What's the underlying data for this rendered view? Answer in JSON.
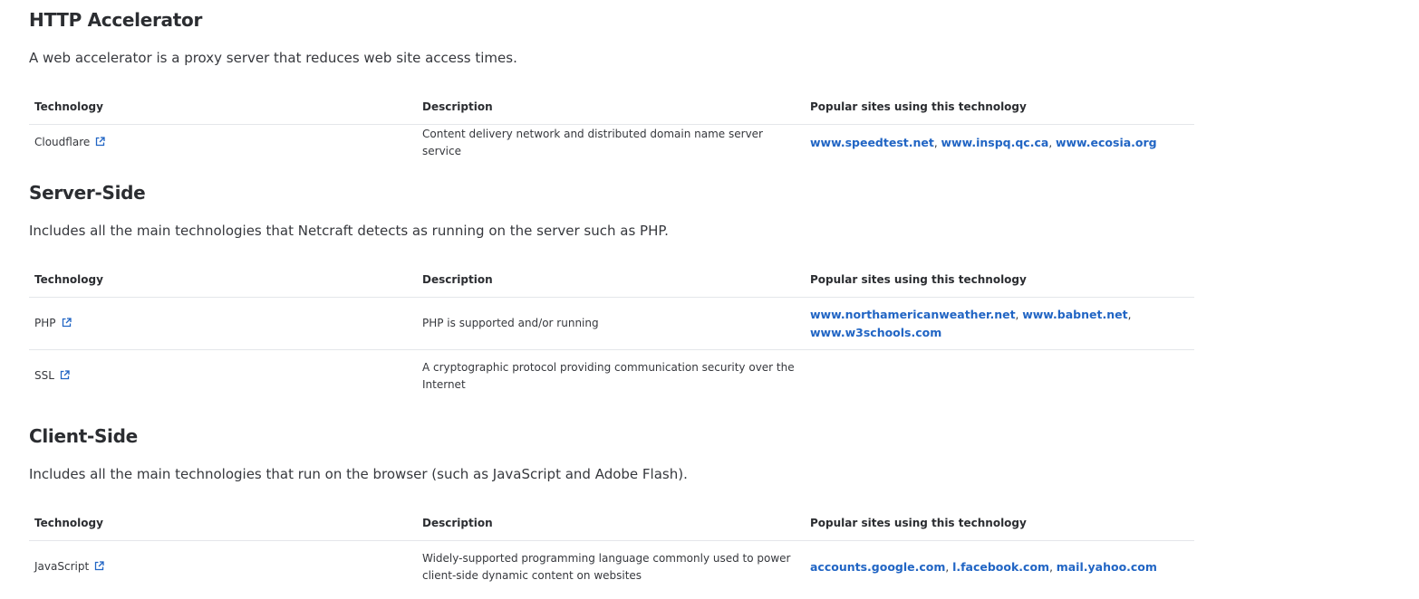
{
  "sections": [
    {
      "title": "HTTP Accelerator",
      "intro": "A web accelerator is a proxy server that reduces web site access times.",
      "columns": [
        "Technology",
        "Description",
        "Popular sites using this technology"
      ],
      "rows": [
        {
          "technology": "Cloudflare",
          "description": "Content delivery network and distributed domain name server service",
          "sites": [
            "www.speedtest.net",
            "www.inspq.qc.ca",
            "www.ecosia.org"
          ]
        }
      ]
    },
    {
      "title": "Server-Side",
      "intro": "Includes all the main technologies that Netcraft detects as running on the server such as PHP.",
      "columns": [
        "Technology",
        "Description",
        "Popular sites using this technology"
      ],
      "rows": [
        {
          "technology": "PHP",
          "description": "PHP is supported and/or running",
          "sites": [
            "www.northamericanweather.net",
            "www.babnet.net",
            "www.w3schools.com"
          ]
        },
        {
          "technology": "SSL",
          "description": "A cryptographic protocol providing communication security over the Internet",
          "sites": []
        }
      ]
    },
    {
      "title": "Client-Side",
      "intro": "Includes all the main technologies that run on the browser (such as JavaScript and Adobe Flash).",
      "columns": [
        "Technology",
        "Description",
        "Popular sites using this technology"
      ],
      "rows": [
        {
          "technology": "JavaScript",
          "description": "Widely-supported programming language commonly used to power client-side dynamic content on websites",
          "sites": [
            "accounts.google.com",
            "l.facebook.com",
            "mail.yahoo.com"
          ]
        }
      ]
    }
  ],
  "colors": {
    "link": "#2165c4",
    "text": "#2b2d31",
    "border": "#e4e6ea"
  },
  "icons": {
    "external_link": "external-link-icon"
  }
}
